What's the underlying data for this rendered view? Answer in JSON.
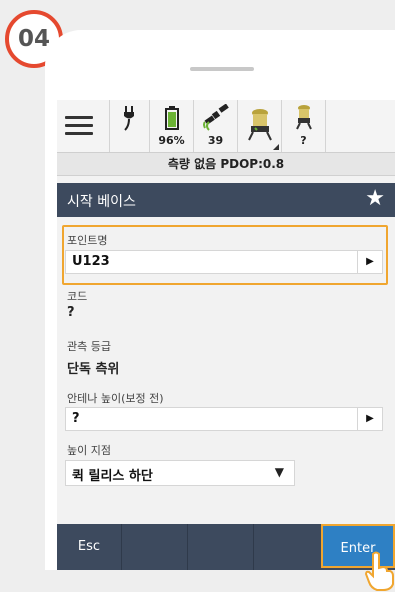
{
  "step_badge": "04",
  "status_bar": {
    "battery_label": "96%",
    "satellites_label": "39",
    "rover_label": "?"
  },
  "info_bar": {
    "text": "측량 없음 PDOP:0.8"
  },
  "title_bar": {
    "title": "시작 베이스"
  },
  "fields": {
    "point_name": {
      "label": "포인트명",
      "value": "U123"
    },
    "code": {
      "label": "코드",
      "value": "?"
    },
    "observation_class": {
      "label": "관측 등급",
      "value": "단독 측위"
    },
    "antenna_height": {
      "label": "안테나 높이(보정 전)",
      "value": "?"
    },
    "measured_to": {
      "label": "높이 지점",
      "value": "퀵 릴리스 하단"
    }
  },
  "bottom_bar": {
    "esc_label": "Esc",
    "enter_label": "Enter"
  },
  "colors": {
    "badge_ring": "#e5492f",
    "header": "#3d4a5e",
    "highlight": "#f0a630",
    "enter_button": "#2e80c4"
  },
  "icons": [
    "menu-icon",
    "plug-icon",
    "battery-icon",
    "satellite-icon",
    "receiver-icon",
    "rover-icon",
    "star-icon",
    "play-arrow-icon",
    "caret-down-icon",
    "hand-pointer-icon"
  ]
}
